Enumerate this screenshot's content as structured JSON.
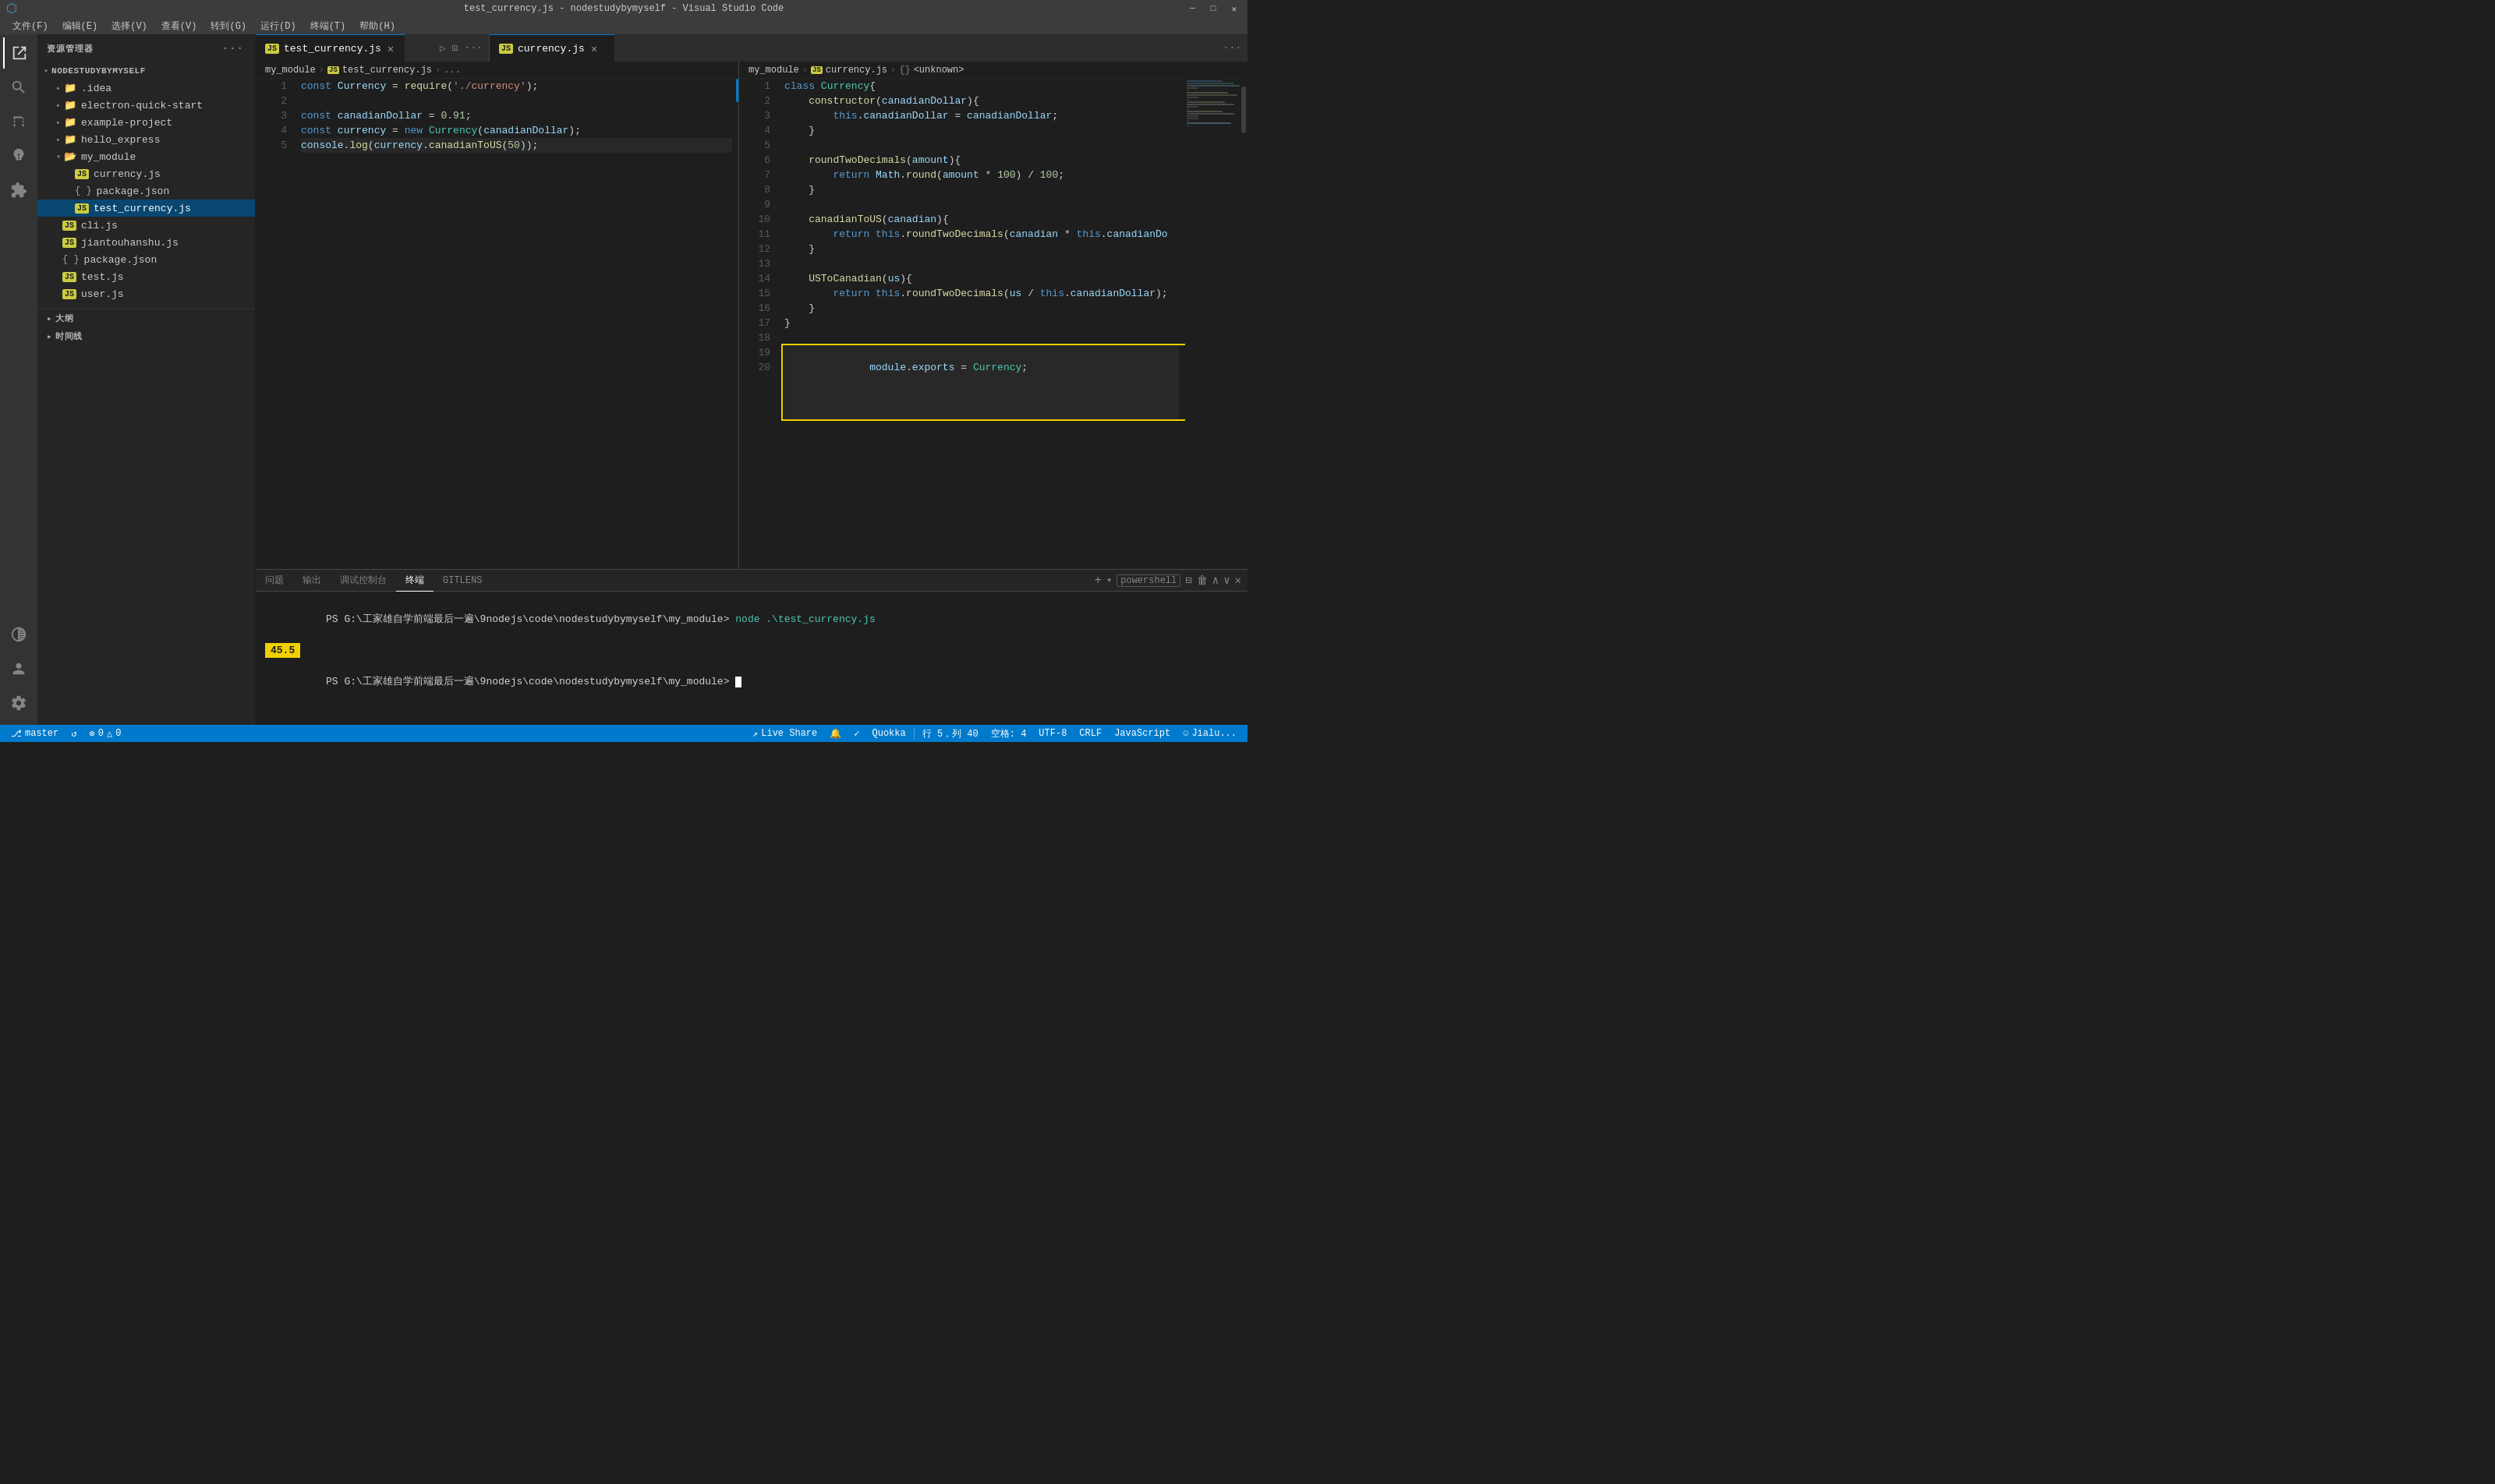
{
  "titleBar": {
    "title": "test_currency.js - nodestudybymyself - Visual Studio Code",
    "controls": [
      "─",
      "□",
      "✕"
    ]
  },
  "menuBar": {
    "items": [
      "文件(F)",
      "编辑(E)",
      "选择(V)",
      "查看(V)",
      "转到(G)",
      "运行(D)",
      "终端(T)",
      "帮助(H)"
    ]
  },
  "tabs": {
    "leftPane": {
      "tab": {
        "label": "test_currency.js",
        "icon": "JS",
        "active": true
      }
    },
    "rightPane": {
      "tab": {
        "label": "currency.js",
        "icon": "JS",
        "active": true
      },
      "moreBtn": "···"
    }
  },
  "breadcrumbs": {
    "left": [
      "my_module",
      ">",
      "JS test_currency.js",
      ">",
      "..."
    ],
    "right": [
      "my_module",
      ">",
      "JS currency.js",
      ">",
      "{} <unknown>"
    ]
  },
  "leftEditor": {
    "lines": [
      {
        "num": 1,
        "code": "const Currency = require('./currency');"
      },
      {
        "num": 2,
        "code": ""
      },
      {
        "num": 3,
        "code": "const canadianDollar = 0.91;"
      },
      {
        "num": 4,
        "code": "const currency = new Currency(canadianDollar);"
      },
      {
        "num": 5,
        "code": "console.log(currency.canadianToUS(50));"
      }
    ]
  },
  "rightEditor": {
    "lines": [
      {
        "num": 1,
        "code": "class Currency{"
      },
      {
        "num": 2,
        "code": "    constructor(canadianDollar){"
      },
      {
        "num": 3,
        "code": "        this.canadianDollar = canadianDollar;"
      },
      {
        "num": 4,
        "code": "    }"
      },
      {
        "num": 5,
        "code": ""
      },
      {
        "num": 6,
        "code": "    roundTwoDecimals(amount){"
      },
      {
        "num": 7,
        "code": "        return Math.round(amount * 100) / 100;"
      },
      {
        "num": 8,
        "code": "    }"
      },
      {
        "num": 9,
        "code": ""
      },
      {
        "num": 10,
        "code": "    canadianToUS(canadian){"
      },
      {
        "num": 11,
        "code": "        return this.roundTwoDecimals(canadian * this.canadianDo"
      },
      {
        "num": 12,
        "code": "    }"
      },
      {
        "num": 13,
        "code": ""
      },
      {
        "num": 14,
        "code": "    USToCanadian(us){"
      },
      {
        "num": 15,
        "code": "        return this.roundTwoDecimals(us / this.canadianDollar);"
      },
      {
        "num": 16,
        "code": "    }"
      },
      {
        "num": 17,
        "code": "}"
      },
      {
        "num": 18,
        "code": ""
      },
      {
        "num": 19,
        "code": "module.exports = Currency;",
        "highlighted": true
      },
      {
        "num": 20,
        "code": ""
      }
    ]
  },
  "sidebar": {
    "title": "资源管理器",
    "moreBtn": "···",
    "sections": {
      "rootFolder": "NODESTUDYBYMYSELF",
      "folders": [
        {
          "name": ".idea",
          "type": "folder",
          "indent": 1,
          "expanded": false
        },
        {
          "name": "electron-quick-start",
          "type": "folder",
          "indent": 1,
          "expanded": false
        },
        {
          "name": "example-project",
          "type": "folder",
          "indent": 1,
          "expanded": false
        },
        {
          "name": "hello_express",
          "type": "folder",
          "indent": 1,
          "expanded": false
        },
        {
          "name": "my_module",
          "type": "folder",
          "indent": 1,
          "expanded": true
        },
        {
          "name": "currency.js",
          "type": "js",
          "indent": 2
        },
        {
          "name": "package.json",
          "type": "json",
          "indent": 2
        },
        {
          "name": "test_currency.js",
          "type": "js",
          "indent": 2,
          "selected": true
        },
        {
          "name": "cli.js",
          "type": "js",
          "indent": 1
        },
        {
          "name": "jiantouhanshu.js",
          "type": "js",
          "indent": 1
        },
        {
          "name": "package.json",
          "type": "json",
          "indent": 1
        },
        {
          "name": "test.js",
          "type": "js",
          "indent": 1
        },
        {
          "name": "user.js",
          "type": "js",
          "indent": 1
        }
      ]
    },
    "outline": "大纲",
    "timeline": "时间线"
  },
  "terminal": {
    "tabs": [
      "问题",
      "输出",
      "调试控制台",
      "终端",
      "GITLENS"
    ],
    "activeTab": "终端",
    "controls": [
      "+",
      "⌵",
      "powershell",
      "⊟",
      "🗑",
      "∧",
      "∨",
      "✕"
    ],
    "lines": [
      {
        "type": "command",
        "text": "PS G:\\工家雄自学前端最后一遍\\9nodejs\\code\\nodestudybymyself\\my_module> node .\\test_currency.js"
      },
      {
        "type": "output",
        "text": "45.5",
        "highlighted": true
      },
      {
        "type": "prompt",
        "text": "PS G:\\工家雄自学前端最后一遍\\9nodejs\\code\\nodestudybymyself\\my_module> "
      }
    ]
  },
  "statusBar": {
    "left": {
      "branch": "master",
      "sync": "↺",
      "errors": "⊗ 0",
      "warnings": "△ 0"
    },
    "right": {
      "liveshare": "Live Share",
      "quokka": "Quokka",
      "line": "行 5，列 40",
      "spaces": "空格: 4",
      "encoding": "UTF-8",
      "lineEnding": "CRLF",
      "language": "JavaScript",
      "feedback": "☺ Jialu..."
    }
  }
}
